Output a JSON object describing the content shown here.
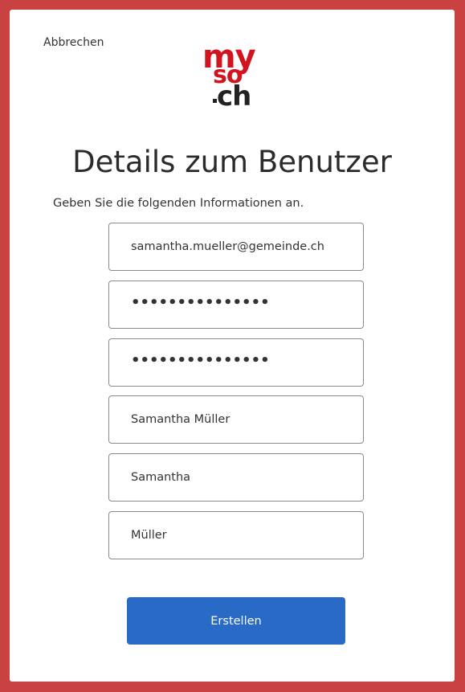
{
  "header": {
    "cancel_label": "Abbrechen"
  },
  "logo": {
    "line1": "my",
    "line2": "so",
    "line3": "ch"
  },
  "page_title": "Details zum Benutzer",
  "intro_text": "Geben Sie die folgenden Informationen an.",
  "fields": [
    {
      "name": "email",
      "value": "samantha.mueller@gemeinde.ch"
    },
    {
      "name": "password",
      "value": "•••••••••••••••"
    },
    {
      "name": "password-confirm",
      "value": "•••••••••••••••"
    },
    {
      "name": "display-name",
      "value": "Samantha Müller"
    },
    {
      "name": "given-name",
      "value": "Samantha"
    },
    {
      "name": "surname",
      "value": "Müller"
    }
  ],
  "submit_label": "Erstellen",
  "colors": {
    "frame": "#c94141",
    "brand_red": "#d1141f",
    "button": "#2a6ac7"
  }
}
